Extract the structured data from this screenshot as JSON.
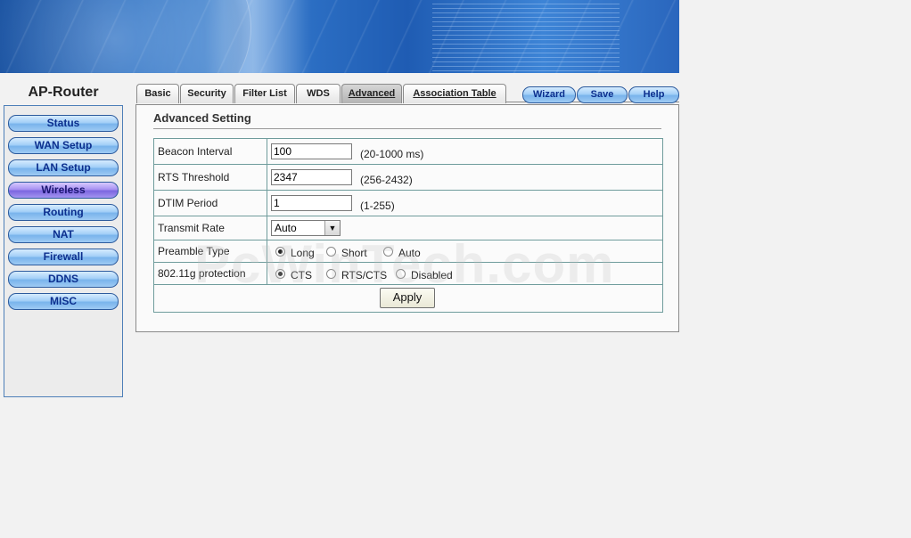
{
  "sidebar": {
    "brand": "AP-Router",
    "items": [
      {
        "label": "Status"
      },
      {
        "label": "WAN Setup"
      },
      {
        "label": "LAN Setup"
      },
      {
        "label": "Wireless",
        "active": true
      },
      {
        "label": "Routing"
      },
      {
        "label": "NAT"
      },
      {
        "label": "Firewall"
      },
      {
        "label": "DDNS"
      },
      {
        "label": "MISC"
      }
    ]
  },
  "tabs": [
    {
      "label": "Basic"
    },
    {
      "label": "Security"
    },
    {
      "label": "Filter List"
    },
    {
      "label": "WDS"
    },
    {
      "label": "Advanced",
      "active": true
    },
    {
      "label": "Association Table"
    }
  ],
  "top_buttons": {
    "wizard": "Wizard",
    "save": "Save",
    "help": "Help"
  },
  "section_title": "Advanced Setting",
  "settings": {
    "beacon_interval": {
      "label": "Beacon Interval",
      "value": "100",
      "hint": "(20-1000 ms)"
    },
    "rts_threshold": {
      "label": "RTS Threshold",
      "value": "2347",
      "hint": "(256-2432)"
    },
    "dtim_period": {
      "label": "DTIM Period",
      "value": "1",
      "hint": "(1-255)"
    },
    "transmit_rate": {
      "label": "Transmit Rate",
      "value": "Auto"
    },
    "preamble_type": {
      "label": "Preamble Type",
      "options": [
        "Long",
        "Short",
        "Auto"
      ],
      "selected": "Long"
    },
    "protection": {
      "label": "802.11g protection",
      "options": [
        "CTS",
        "RTS/CTS",
        "Disabled"
      ],
      "selected": "CTS"
    },
    "apply_label": "Apply"
  },
  "watermark": "PcWinTech.com",
  "colors": {
    "nav_blue": "#a3cff7",
    "nav_active": "#a892f1",
    "table_border": "#6f9c9c"
  }
}
